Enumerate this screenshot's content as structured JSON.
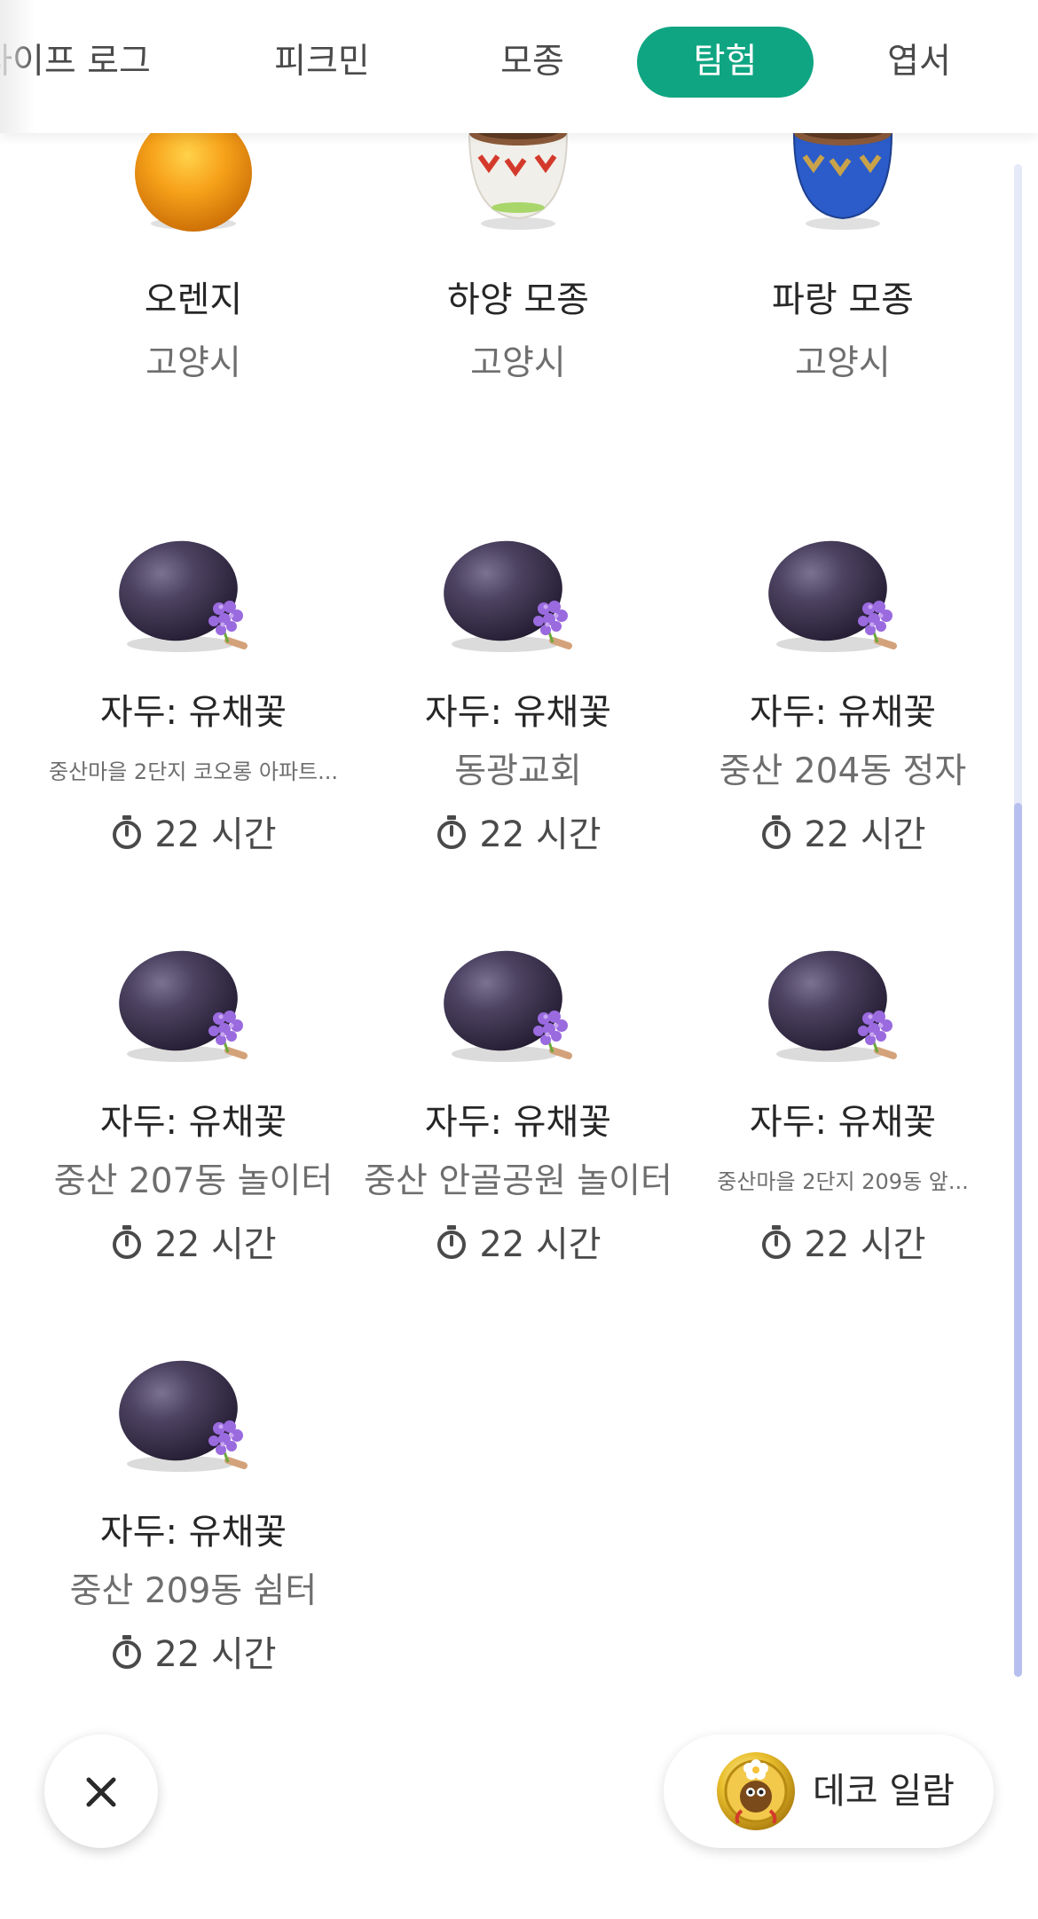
{
  "tabs": [
    {
      "label": "라이프 로그",
      "active": false
    },
    {
      "label": "피크민",
      "active": false
    },
    {
      "label": "모종",
      "active": false
    },
    {
      "label": "탐험",
      "active": true
    },
    {
      "label": "엽서",
      "active": false
    }
  ],
  "items": [
    {
      "icon": "orange-fruit-icon",
      "title": "오렌지",
      "location": "고양시",
      "time": ""
    },
    {
      "icon": "white-seedling-pot-icon",
      "title": "하양 모종",
      "location": "고양시",
      "time": ""
    },
    {
      "icon": "blue-seedling-pot-icon",
      "title": "파랑 모종",
      "location": "고양시",
      "time": ""
    },
    {
      "icon": "plum-with-flower-icon",
      "title": "자두: 유채꽃",
      "location": "중산마을 2단지 코오롱 아파트...",
      "time": "22 시간"
    },
    {
      "icon": "plum-with-flower-icon",
      "title": "자두: 유채꽃",
      "location": "동광교회",
      "time": "22 시간"
    },
    {
      "icon": "plum-with-flower-icon",
      "title": "자두: 유채꽃",
      "location": "중산 204동 정자",
      "time": "22 시간"
    },
    {
      "icon": "plum-with-flower-icon",
      "title": "자두: 유채꽃",
      "location": "중산 207동 놀이터",
      "time": "22 시간"
    },
    {
      "icon": "plum-with-flower-icon",
      "title": "자두: 유채꽃",
      "location": "중산 안골공원 놀이터",
      "time": "22 시간"
    },
    {
      "icon": "plum-with-flower-icon",
      "title": "자두: 유채꽃",
      "location": "중산마을 2단지 209동 앞...",
      "time": "22 시간"
    },
    {
      "icon": "plum-with-flower-icon",
      "title": "자두: 유채꽃",
      "location": "중산 209동 쉼터",
      "time": "22 시간"
    }
  ],
  "bottom": {
    "close_icon": "close-icon",
    "deco_label": "데코 일람",
    "deco_icon": "deco-badge-icon"
  },
  "colors": {
    "accent": "#0fa582",
    "scroll_track": "#e6e9f8",
    "scroll_thumb": "#b7bfee"
  }
}
